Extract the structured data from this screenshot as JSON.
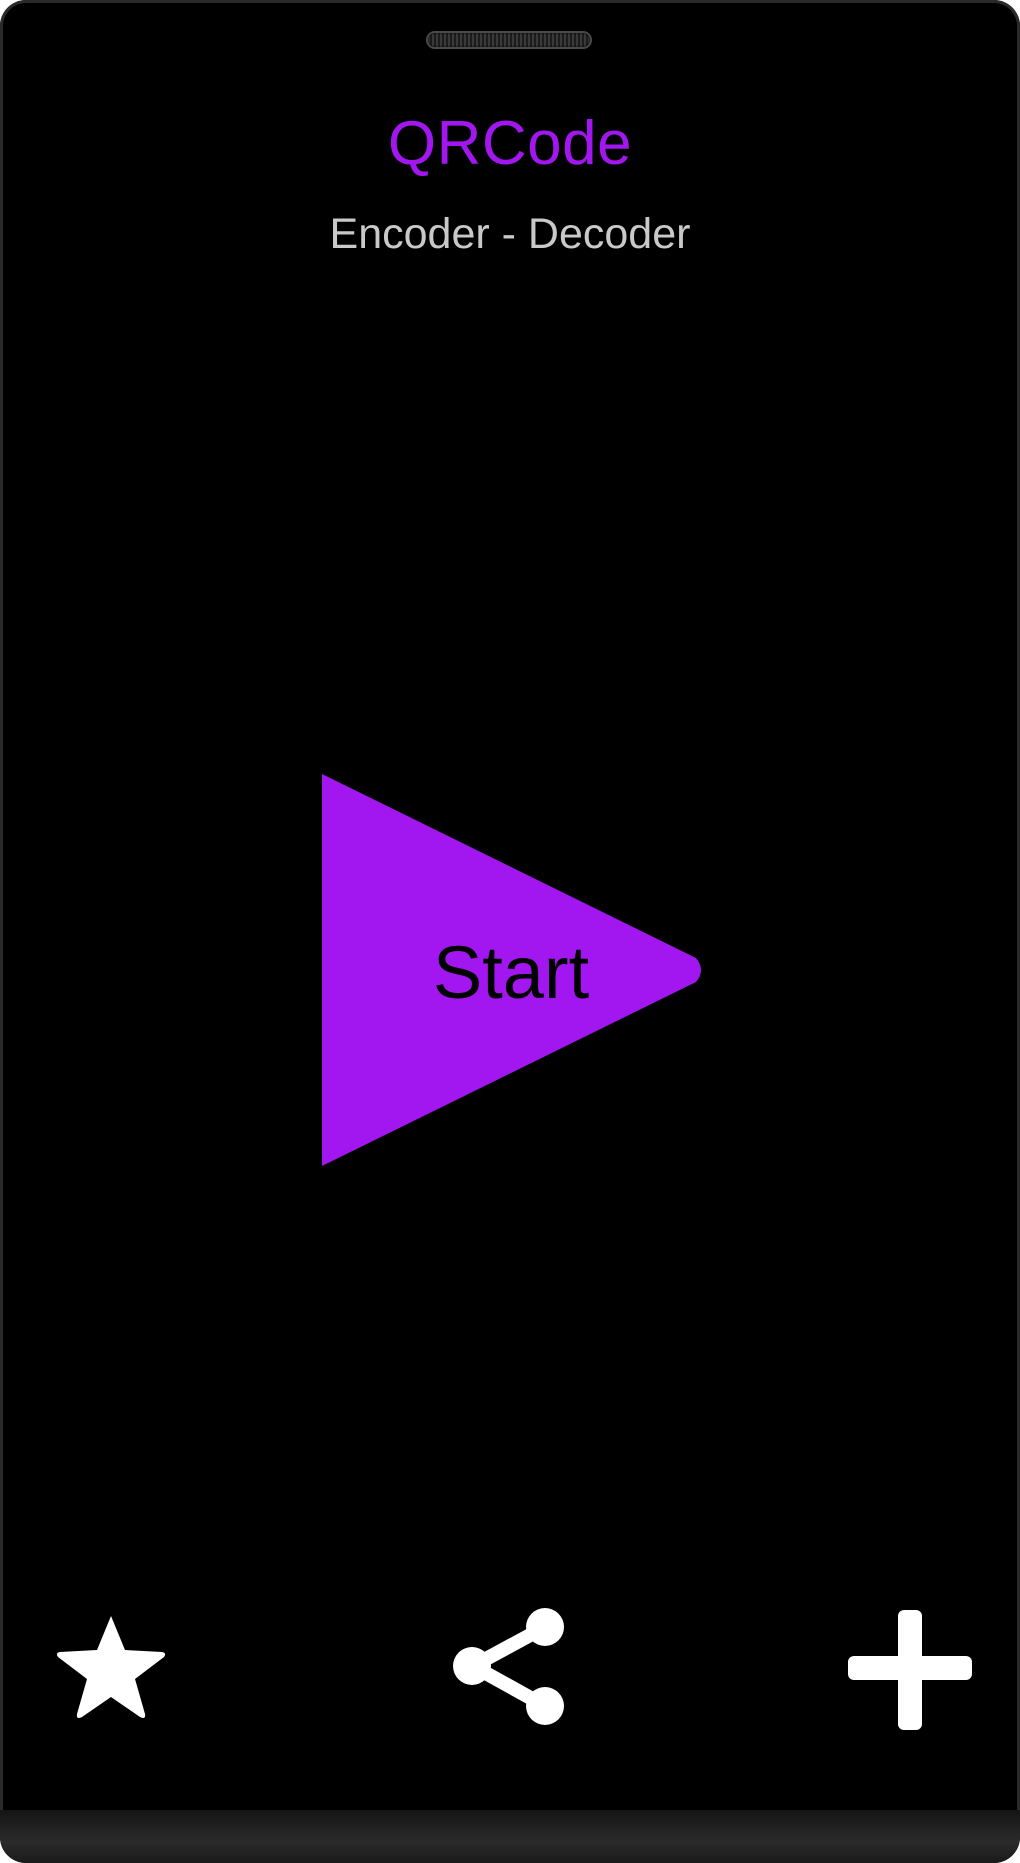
{
  "app": {
    "title": "QRCode",
    "subtitle": "Encoder - Decoder"
  },
  "start_button": {
    "label": "Start"
  },
  "toolbar": {
    "items": [
      {
        "icon": "star-icon"
      },
      {
        "icon": "share-icon"
      },
      {
        "icon": "plus-icon"
      }
    ]
  },
  "colors": {
    "accent": "#a216ef",
    "background": "#000000",
    "subtitle": "#c9c9c9",
    "icon": "#ffffff"
  }
}
